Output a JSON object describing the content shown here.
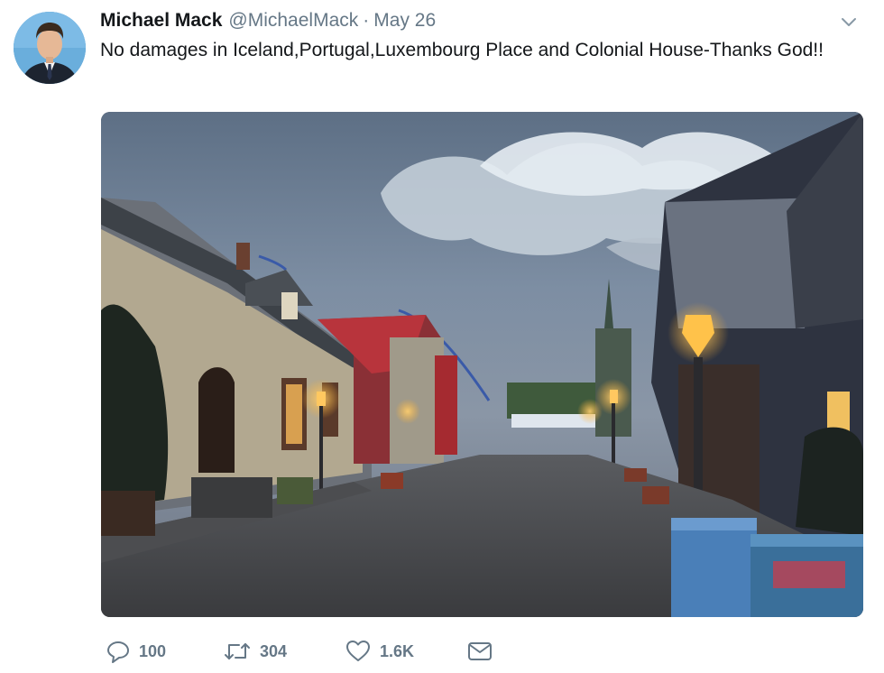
{
  "tweet": {
    "author_name": "Michael Mack",
    "author_handle": "@MichaelMack",
    "separator": "·",
    "date": "May 26",
    "text": "No damages in Iceland,Portugal,Luxembourg Place and Colonial House-Thanks God!!",
    "replies": "100",
    "retweets": "304",
    "likes": "1.6K"
  },
  "icons": {
    "avatar": "avatar",
    "caret": "chevron-down-icon",
    "reply": "reply-icon",
    "retweet": "retweet-icon",
    "like": "heart-icon",
    "message": "envelope-icon"
  },
  "colors": {
    "text": "#14171a",
    "secondary": "#657786"
  }
}
